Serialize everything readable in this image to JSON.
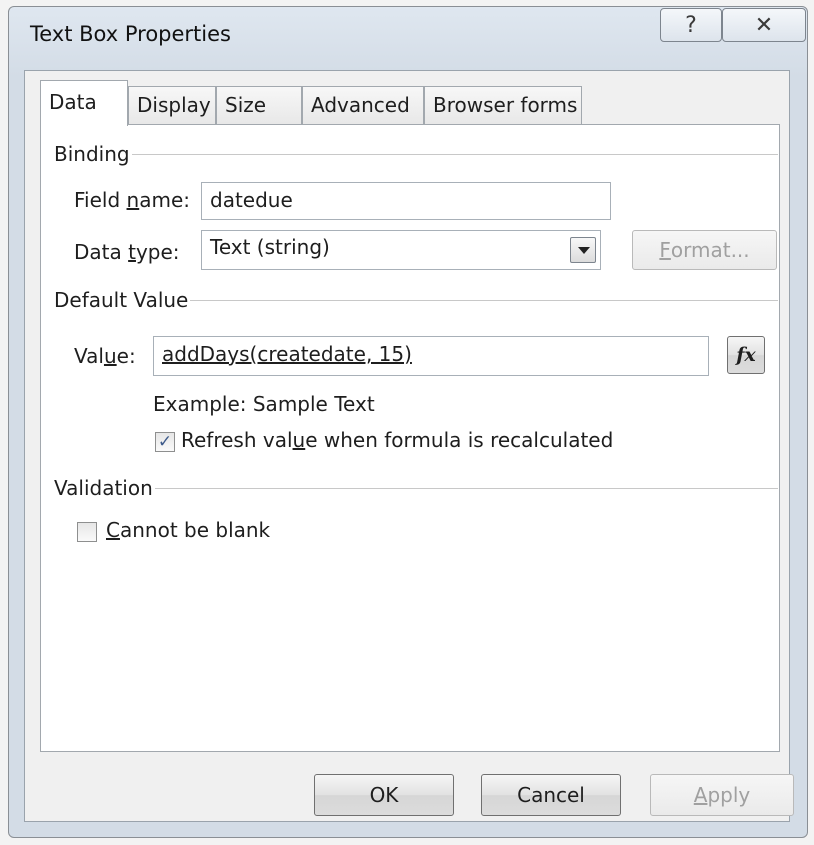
{
  "window": {
    "title": "Text Box Properties",
    "help_glyph": "?",
    "close_glyph": "✕"
  },
  "tabs": [
    {
      "label": "Data",
      "active": true
    },
    {
      "label": "Display",
      "active": false
    },
    {
      "label": "Size",
      "active": false
    },
    {
      "label": "Advanced",
      "active": false
    },
    {
      "label": "Browser forms",
      "active": false
    }
  ],
  "binding": {
    "heading": "Binding",
    "field_name_label_pre": "Field ",
    "field_name_label_accel": "n",
    "field_name_label_post": "ame:",
    "field_name_value": "datedue",
    "data_type_label_pre": "Data ",
    "data_type_label_accel": "t",
    "data_type_label_post": "ype:",
    "data_type_value": "Text (string)",
    "format_button_accel": "F",
    "format_button_rest": "ormat..."
  },
  "default_value": {
    "heading": "Default Value",
    "value_label_pre": "Val",
    "value_label_accel": "u",
    "value_label_post": "e:",
    "value": "addDays(createdate, 15)",
    "fx_label": "fx",
    "example": "Example: Sample Text",
    "refresh_checked": true,
    "refresh_label_pre": "Refresh val",
    "refresh_label_accel": "u",
    "refresh_label_post": "e when formula is recalculated"
  },
  "validation": {
    "heading": "Validation",
    "cannot_blank_checked": false,
    "cannot_blank_accel": "C",
    "cannot_blank_rest": "annot be blank"
  },
  "footer": {
    "ok": "OK",
    "cancel": "Cancel",
    "apply_accel": "A",
    "apply_rest": "pply"
  }
}
